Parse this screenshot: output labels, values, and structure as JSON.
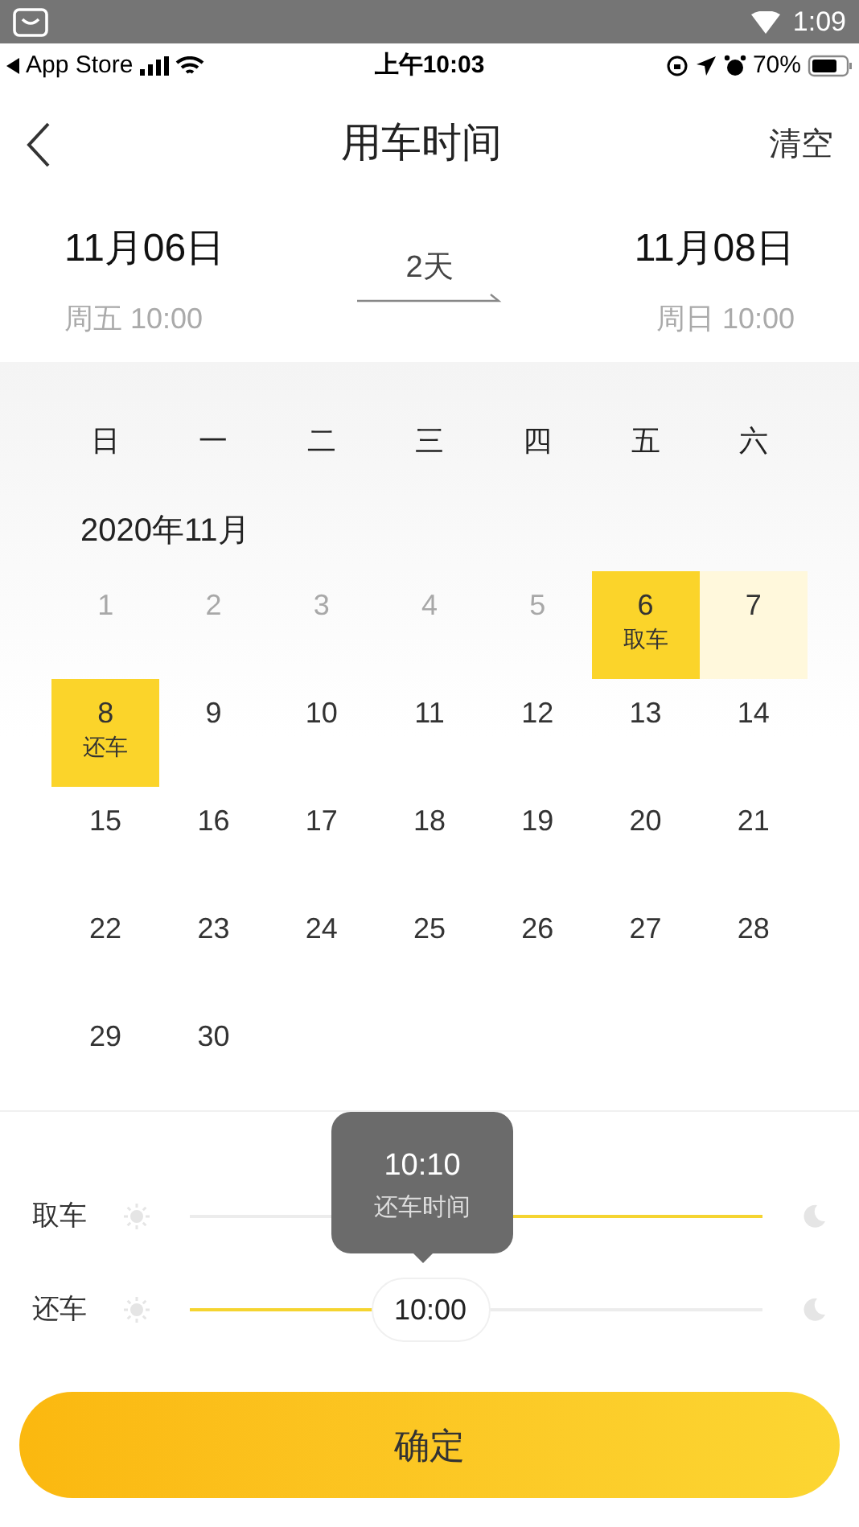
{
  "android_status": {
    "time": "1:09"
  },
  "ios_status": {
    "carrier": "App Store",
    "time": "上午10:03",
    "battery": "70%"
  },
  "header": {
    "title": "用车时间",
    "action": "清空"
  },
  "range": {
    "start": {
      "date": "11月06日",
      "sub": "周五 10:00"
    },
    "duration": "2天",
    "end": {
      "date": "11月08日",
      "sub": "周日 10:00"
    }
  },
  "weekdays": [
    "日",
    "一",
    "二",
    "三",
    "四",
    "五",
    "六"
  ],
  "month": "2020年11月",
  "days": [
    {
      "day": "1",
      "disabled": true,
      "selected": false,
      "in_range": false
    },
    {
      "day": "2",
      "disabled": true,
      "selected": false,
      "in_range": false
    },
    {
      "day": "3",
      "disabled": true,
      "selected": false,
      "in_range": false
    },
    {
      "day": "4",
      "disabled": true,
      "selected": false,
      "in_range": false
    },
    {
      "day": "5",
      "disabled": true,
      "selected": false,
      "in_range": false
    },
    {
      "day": "6",
      "disabled": false,
      "selected": true,
      "in_range": false,
      "note": "取车"
    },
    {
      "day": "7",
      "disabled": false,
      "selected": false,
      "in_range": true
    },
    {
      "day": "8",
      "disabled": false,
      "selected": true,
      "in_range": false,
      "note": "还车"
    },
    {
      "day": "9",
      "disabled": false,
      "selected": false,
      "in_range": false
    },
    {
      "day": "10",
      "disabled": false,
      "selected": false,
      "in_range": false
    },
    {
      "day": "11",
      "disabled": false,
      "selected": false,
      "in_range": false
    },
    {
      "day": "12",
      "disabled": false,
      "selected": false,
      "in_range": false
    },
    {
      "day": "13",
      "disabled": false,
      "selected": false,
      "in_range": false
    },
    {
      "day": "14",
      "disabled": false,
      "selected": false,
      "in_range": false
    },
    {
      "day": "15",
      "disabled": false,
      "selected": false,
      "in_range": false
    },
    {
      "day": "16",
      "disabled": false,
      "selected": false,
      "in_range": false
    },
    {
      "day": "17",
      "disabled": false,
      "selected": false,
      "in_range": false
    },
    {
      "day": "18",
      "disabled": false,
      "selected": false,
      "in_range": false
    },
    {
      "day": "19",
      "disabled": false,
      "selected": false,
      "in_range": false
    },
    {
      "day": "20",
      "disabled": false,
      "selected": false,
      "in_range": false
    },
    {
      "day": "21",
      "disabled": false,
      "selected": false,
      "in_range": false
    },
    {
      "day": "22",
      "disabled": false,
      "selected": false,
      "in_range": false
    },
    {
      "day": "23",
      "disabled": false,
      "selected": false,
      "in_range": false
    },
    {
      "day": "24",
      "disabled": false,
      "selected": false,
      "in_range": false
    },
    {
      "day": "25",
      "disabled": false,
      "selected": false,
      "in_range": false
    },
    {
      "day": "26",
      "disabled": false,
      "selected": false,
      "in_range": false
    },
    {
      "day": "27",
      "disabled": false,
      "selected": false,
      "in_range": false
    },
    {
      "day": "28",
      "disabled": false,
      "selected": false,
      "in_range": false
    },
    {
      "day": "29",
      "disabled": false,
      "selected": false,
      "in_range": false
    },
    {
      "day": "30",
      "disabled": false,
      "selected": false,
      "in_range": false
    }
  ],
  "sliders": [
    {
      "label": "取车",
      "level": 0.42,
      "fill_right": true
    },
    {
      "label": "还车",
      "level": 0.42,
      "fill_right": false,
      "value": "10:00"
    }
  ],
  "tooltip": {
    "time": "10:10",
    "caption": "还车时间"
  },
  "confirm": "确定"
}
